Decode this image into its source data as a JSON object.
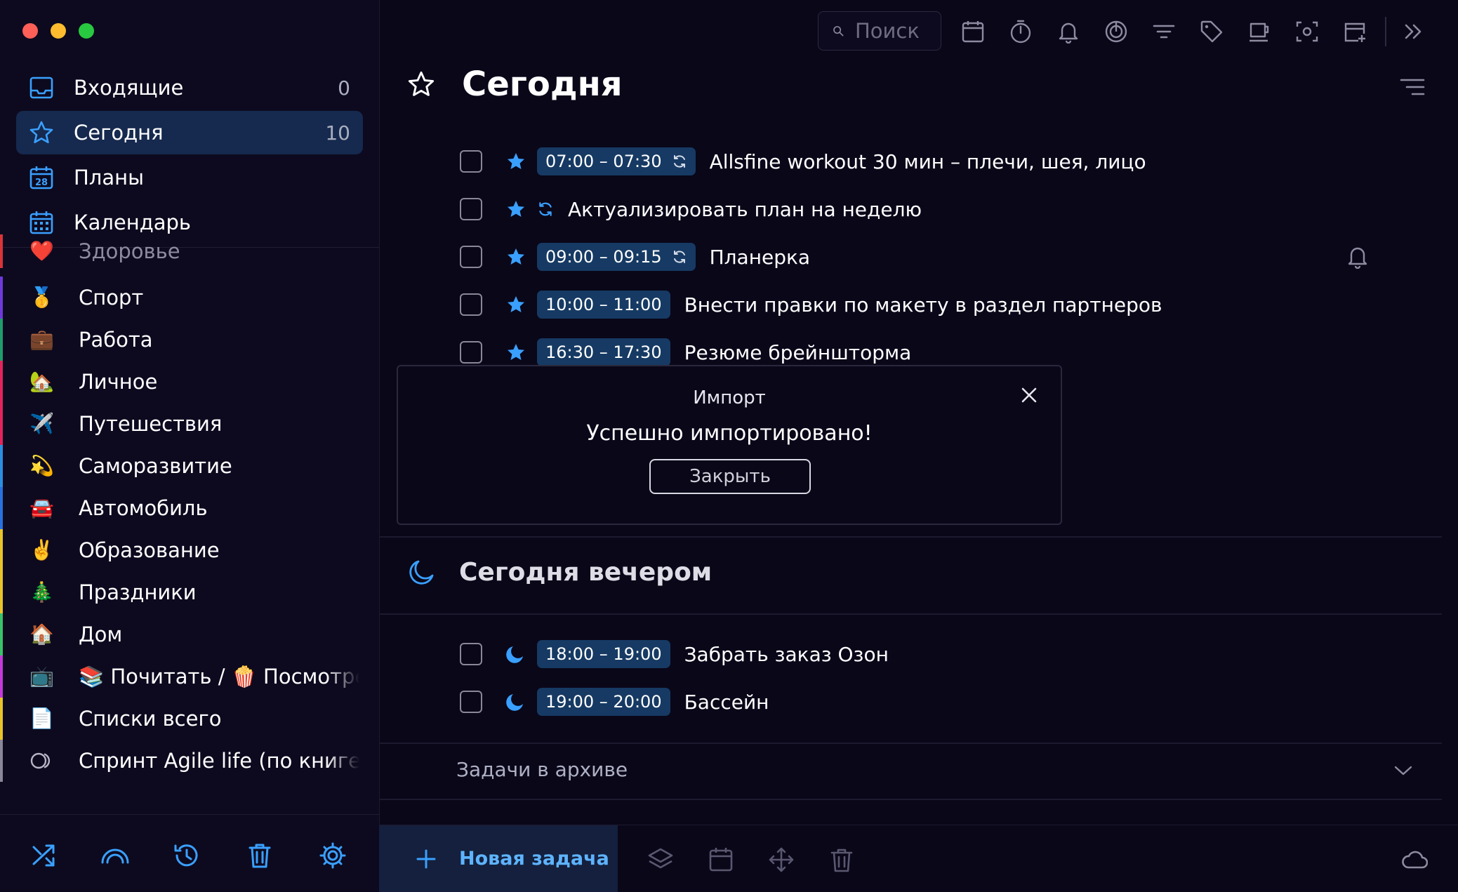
{
  "sidebar": {
    "nav": [
      {
        "label": "Входящие",
        "count": "0",
        "icon": "inbox-icon"
      },
      {
        "label": "Сегодня",
        "count": "10",
        "icon": "star-icon"
      },
      {
        "label": "Планы",
        "count": "",
        "icon": "calendar-28-icon",
        "calendar_day": "28"
      },
      {
        "label": "Календарь",
        "count": "",
        "icon": "calendar-grid-icon"
      }
    ],
    "lists": [
      {
        "label": "Здоровье",
        "emoji": "❤️",
        "color": "#d9343a"
      },
      {
        "label": "Спорт",
        "emoji": "🥇",
        "color": "#6d3ad9"
      },
      {
        "label": "Работа",
        "emoji": "💼",
        "color": "#1f9e6b"
      },
      {
        "label": "Личное",
        "emoji": "🏡",
        "color": "#e2245a"
      },
      {
        "label": "Путешествия",
        "emoji": "✈️",
        "color": "#e2245a"
      },
      {
        "label": "Саморазвитие",
        "emoji": "💫",
        "color": "#2a8fe0"
      },
      {
        "label": "Автомобиль",
        "emoji": "🚘",
        "color": "#2a6fe0"
      },
      {
        "label": "Образование",
        "emoji": "✌️",
        "color": "#e8c42a"
      },
      {
        "label": "Праздники",
        "emoji": "🎄",
        "color": "#e8c42a"
      },
      {
        "label": "Дом",
        "emoji": "🏠",
        "color": "#3ac26a"
      },
      {
        "label": "📚 Почитать / 🍿 Посмотреть",
        "emoji": "📺",
        "color": "#c43ad9"
      },
      {
        "label": "Списки всего",
        "emoji": "📄",
        "color": "#e8c42a"
      },
      {
        "label": "Спринт Agile life (по книге",
        "emoji": "",
        "icon": "toggle-icon",
        "color": "#8a8799"
      }
    ],
    "bottom_icons": [
      "shuffle-icon",
      "rainbow-icon",
      "history-icon",
      "trash-icon",
      "settings-icon"
    ]
  },
  "toolbar": {
    "search_placeholder": "Поиск",
    "icons": [
      "calendar-icon",
      "timer-icon",
      "bell-icon",
      "pomodoro-icon",
      "filter-icon",
      "tag-icon",
      "mug-icon",
      "focus-icon",
      "add-calendar-icon",
      "double-chevron-icon"
    ]
  },
  "main": {
    "title": "Сегодня",
    "tasks": [
      {
        "time": "07:00 – 07:30",
        "text": "Allsfine workout 30 мин – плечи, шея, лицо",
        "repeat": true
      },
      {
        "time": "",
        "text": "Актуализировать план на неделю",
        "repeat": true
      },
      {
        "time": "09:00 – 09:15",
        "text": "Планерка",
        "repeat": true,
        "reminder": true
      },
      {
        "time": "10:00 – 11:00",
        "text": "Внести правки по макету в раздел партнеров",
        "repeat": false
      },
      {
        "time": "16:30 – 17:30",
        "text": "Резюме брейншторма",
        "repeat": false
      }
    ],
    "evening": {
      "title": "Сегодня вечером",
      "tasks": [
        {
          "time": "18:00 – 19:00",
          "text": "Забрать заказ Озон"
        },
        {
          "time": "19:00 – 20:00",
          "text": "Бассейн"
        }
      ]
    },
    "archive_label": "Задачи в архиве"
  },
  "modal": {
    "title": "Импорт",
    "message": "Успешно импортировано!",
    "button": "Закрыть"
  },
  "bottombar": {
    "new_task": "Новая задача",
    "icons": [
      "layers-icon",
      "calendar-icon",
      "move-icon",
      "trash-icon",
      "cloud-icon"
    ]
  },
  "colors": {
    "accent": "#3aa0ff",
    "time_chip": "#163a63",
    "active_nav": "#16294e",
    "background": "#0a0719"
  }
}
